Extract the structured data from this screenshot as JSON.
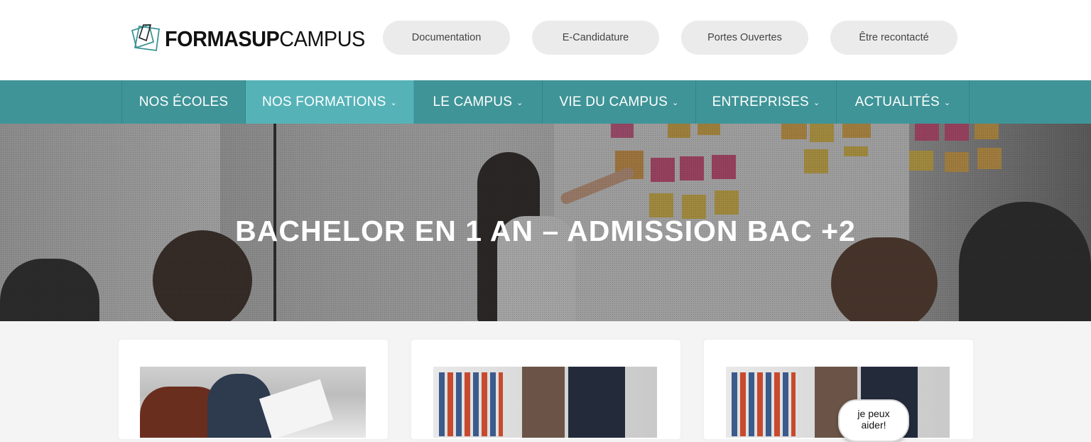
{
  "brand": {
    "name_bold": "FORMASUP",
    "name_regular": "CAMPUS"
  },
  "header": {
    "pills": [
      {
        "label": "Documentation"
      },
      {
        "label": "E-Candidature"
      },
      {
        "label": "Portes Ouvertes"
      },
      {
        "label": "Être recontacté"
      }
    ]
  },
  "nav": {
    "items": [
      {
        "label": "NOS ÉCOLES",
        "dropdown": false,
        "active": false
      },
      {
        "label": "NOS FORMATIONS",
        "dropdown": true,
        "active": true
      },
      {
        "label": "LE CAMPUS",
        "dropdown": true,
        "active": false
      },
      {
        "label": "VIE DU CAMPUS",
        "dropdown": true,
        "active": false
      },
      {
        "label": "ENTREPRISES",
        "dropdown": true,
        "active": false
      },
      {
        "label": "ACTUALITÉS",
        "dropdown": true,
        "active": false
      }
    ],
    "caret": "⌄"
  },
  "hero": {
    "title": "BACHELOR EN 1 AN – ADMISSION BAC +2"
  },
  "chat": {
    "text_line1": "je peux",
    "text_line2": "aider!"
  },
  "colors": {
    "nav_bg": "#3f9497",
    "nav_active": "#55b3b8",
    "pill_bg": "#ebebeb"
  }
}
